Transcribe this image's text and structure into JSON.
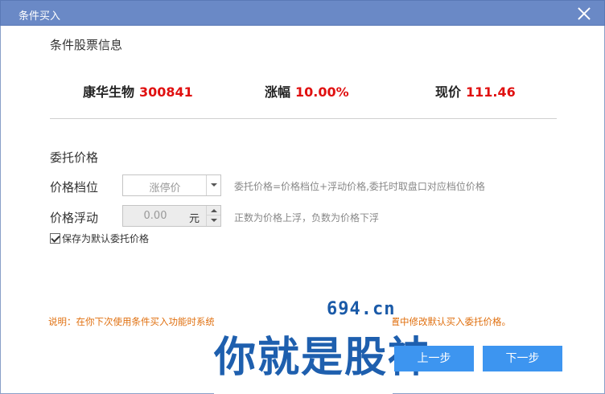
{
  "window": {
    "title": "条件买入"
  },
  "stock_info": {
    "section_title": "条件股票信息",
    "name": "康华生物",
    "code": "300841",
    "change_label": "涨幅",
    "change_value": "10.00%",
    "price_label": "现价",
    "price_value": "111.46"
  },
  "order_price": {
    "section_title": "委托价格",
    "level_label": "价格档位",
    "level_value": "涨停价",
    "level_hint": "委托价格=价格档位+浮动价格,委托时取盘口对应档位价格",
    "float_label": "价格浮动",
    "float_value": "0.00",
    "float_unit": "元",
    "float_hint": "正数为价格上浮，负数为价格下浮",
    "save_default_label": "保存为默认委托价格",
    "save_default_checked": true
  },
  "note": "说明：在你下次使用条件买入功能时系统将默认使用该委托价格，也可以在条件单设置中修改默认买入委托价格。",
  "watermark": {
    "site": "694.cn",
    "slogan": "你就是股神"
  },
  "buttons": {
    "prev": "上一步",
    "next": "下一步"
  },
  "colors": {
    "titlebar": "#6a89c6",
    "accent": "#3d95f0",
    "up_red": "#e01010",
    "note_orange": "#e07010"
  }
}
